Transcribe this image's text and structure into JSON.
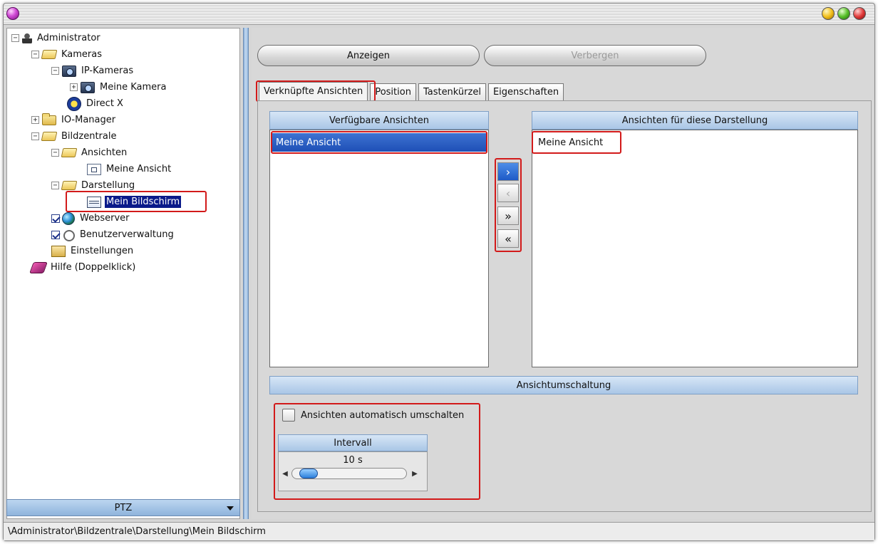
{
  "tree": {
    "items": [
      {
        "label": "Administrator"
      },
      {
        "label": "Kameras"
      },
      {
        "label": "IP-Kameras"
      },
      {
        "label": "Meine Kamera"
      },
      {
        "label": "Direct X"
      },
      {
        "label": "IO-Manager"
      },
      {
        "label": "Bildzentrale"
      },
      {
        "label": "Ansichten"
      },
      {
        "label": "Meine Ansicht"
      },
      {
        "label": "Darstellung"
      },
      {
        "label": "Mein Bildschirm"
      },
      {
        "label": "Webserver"
      },
      {
        "label": "Benutzerverwaltung"
      },
      {
        "label": "Einstellungen"
      },
      {
        "label": "Hilfe (Doppelklick)"
      }
    ],
    "expander_minus": "−",
    "expander_plus": "+"
  },
  "ptz": {
    "label": "PTZ"
  },
  "actions": {
    "show": "Anzeigen",
    "hide": "Verbergen"
  },
  "tabs": [
    "Verknüpfte Ansichten",
    "Position",
    "Tastenkürzel",
    "Eigenschaften"
  ],
  "available": {
    "header": "Verfügbare Ansichten",
    "items": [
      "Meine Ansicht"
    ]
  },
  "assigned": {
    "header": "Ansichten für diese Darstellung",
    "items": [
      "Meine Ansicht"
    ]
  },
  "transfer": {
    "add": "›",
    "remove": "‹",
    "add_all": "»",
    "remove_all": "«"
  },
  "switching": {
    "header": "Ansichtumschaltung",
    "auto_label": "Ansichten automatisch umschalten",
    "auto_checked": false,
    "interval_header": "Intervall",
    "interval_value": "10 s",
    "slider_left": "◀",
    "slider_right": "▶"
  },
  "status": {
    "path": "\\Administrator\\Bildzentrale\\Darstellung\\Mein Bildschirm"
  },
  "colors": {
    "highlight": "#d21a1a",
    "selection": "#0a1a8a",
    "header_blue": "#a9c6e6"
  }
}
